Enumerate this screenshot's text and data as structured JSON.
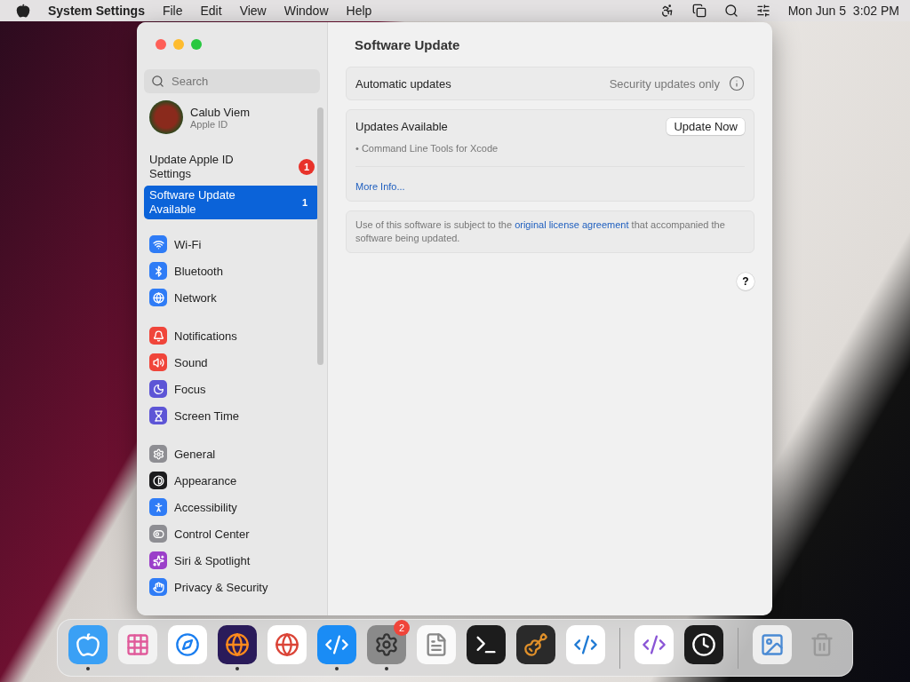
{
  "menubar": {
    "app": "System Settings",
    "menus": [
      "File",
      "Edit",
      "View",
      "Window",
      "Help"
    ],
    "clock": "Mon Jun 5  3:02 PM"
  },
  "window": {
    "title": "Software Update"
  },
  "sidebar": {
    "search": {
      "placeholder": "Search"
    },
    "account": {
      "name": "Calub Viem",
      "subtitle": "Apple ID"
    },
    "notices": [
      {
        "label": "Update Apple ID Settings",
        "badge": "1",
        "selected": false
      },
      {
        "label": "Software Update Available",
        "badge": "1",
        "selected": true
      }
    ],
    "groups": [
      [
        {
          "label": "Wi-Fi",
          "kind": "wifi",
          "color": "#2f7cf6",
          "selected": false
        },
        {
          "label": "Bluetooth",
          "kind": "bluetooth",
          "color": "#2f7cf6",
          "selected": false
        },
        {
          "label": "Network",
          "kind": "network",
          "color": "#2f7cf6",
          "selected": false
        }
      ],
      [
        {
          "label": "Notifications",
          "kind": "notifications",
          "color": "#f0453a",
          "selected": false
        },
        {
          "label": "Sound",
          "kind": "sound",
          "color": "#f0453a",
          "selected": false
        },
        {
          "label": "Focus",
          "kind": "focus",
          "color": "#5d55d6",
          "selected": false
        },
        {
          "label": "Screen Time",
          "kind": "screentime",
          "color": "#5d55d6",
          "selected": false
        }
      ],
      [
        {
          "label": "General",
          "kind": "general",
          "color": "#8e8e93",
          "selected": false
        },
        {
          "label": "Appearance",
          "kind": "appearance",
          "color": "#1c1c1e",
          "selected": false
        },
        {
          "label": "Accessibility",
          "kind": "accessibility",
          "color": "#2f7cf6",
          "selected": false
        },
        {
          "label": "Control Center",
          "kind": "controlcenter",
          "color": "#8e8e93",
          "selected": false
        },
        {
          "label": "Siri & Spotlight",
          "kind": "siri",
          "color": "#9b3fc9",
          "selected": false
        },
        {
          "label": "Privacy & Security",
          "kind": "privacy",
          "color": "#2f7cf6",
          "selected": false
        }
      ]
    ]
  },
  "content": {
    "automatic": {
      "label": "Automatic updates",
      "value": "Security updates only"
    },
    "updates": {
      "title": "Updates Available",
      "items": [
        "• Command Line Tools for Xcode"
      ],
      "button": "Update Now",
      "link": "More Info..."
    },
    "license": {
      "before": "Use of this software is subject to the ",
      "link": "original license agreement",
      "after": " that accompanied the software being updated."
    },
    "help": "?"
  },
  "dock": [
    [
      {
        "kind": "finder",
        "running": true
      },
      {
        "kind": "launchpad",
        "running": false
      },
      {
        "kind": "safari",
        "running": false
      },
      {
        "kind": "firefox",
        "running": true
      },
      {
        "kind": "chrome",
        "running": false
      },
      {
        "kind": "appstore",
        "running": true
      },
      {
        "kind": "settings",
        "running": true,
        "badge": "2"
      },
      {
        "kind": "textedit",
        "running": false
      },
      {
        "kind": "terminal",
        "running": false
      },
      {
        "kind": "garageband",
        "running": false
      },
      {
        "kind": "vscode",
        "running": false
      }
    ],
    [
      {
        "kind": "visualstudio",
        "running": false
      },
      {
        "kind": "clock",
        "running": false
      }
    ],
    [
      {
        "kind": "preview",
        "running": false
      },
      {
        "kind": "trash",
        "running": false
      }
    ]
  ]
}
